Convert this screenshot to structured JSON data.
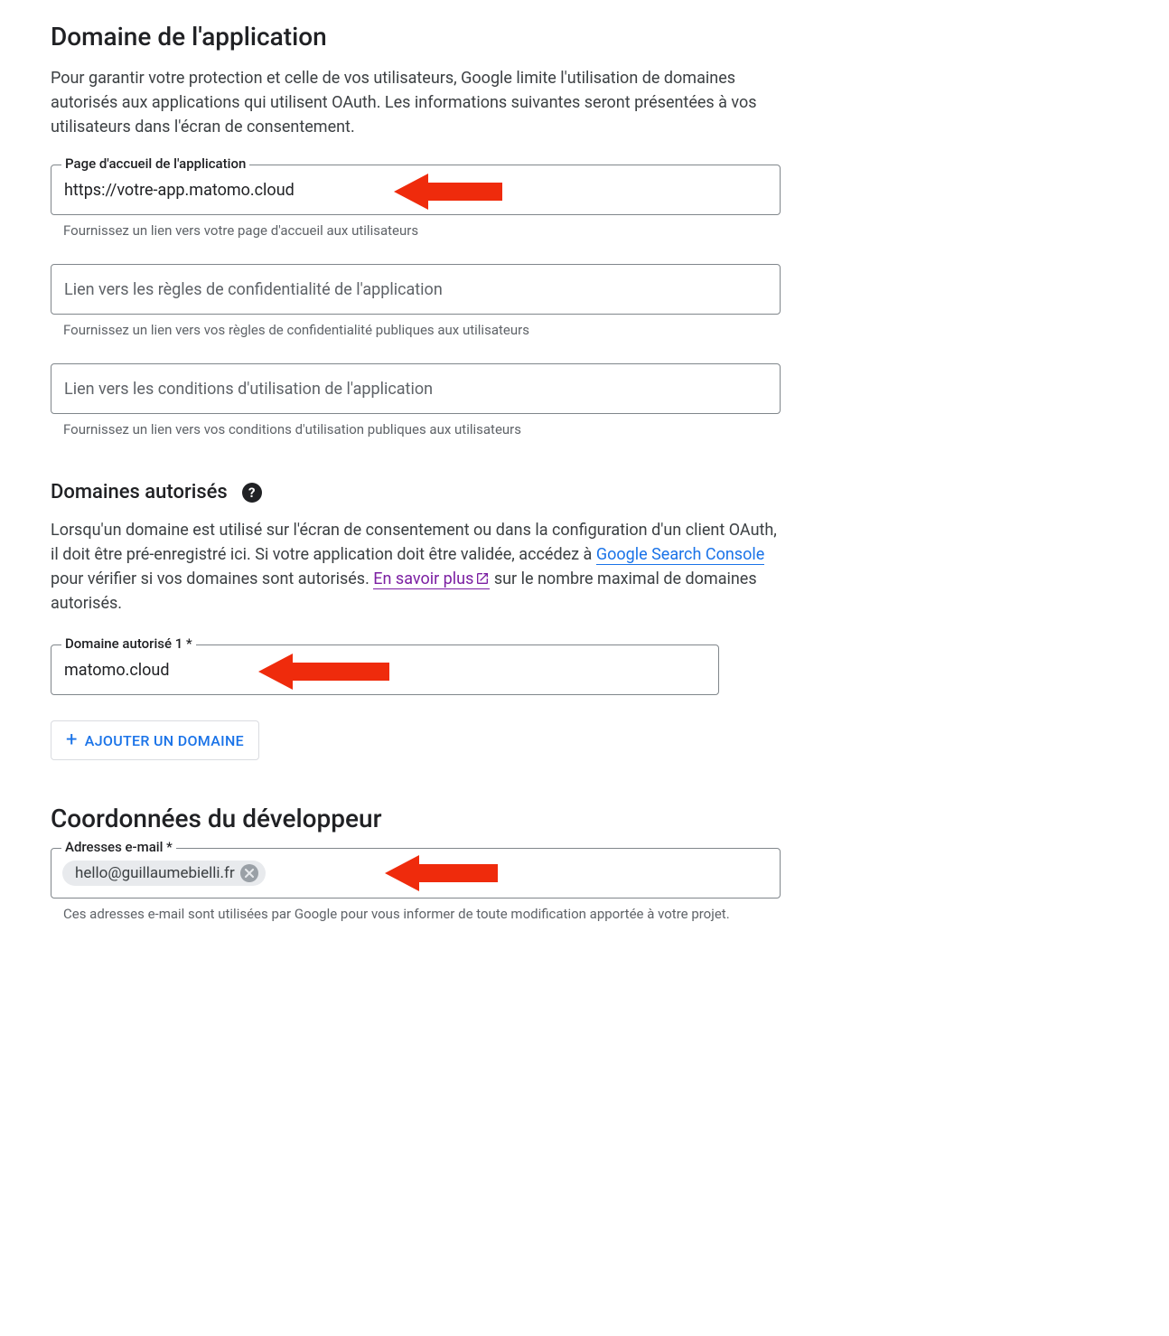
{
  "section_domain": {
    "title": "Domaine de l'application",
    "description": "Pour garantir votre protection et celle de vos utilisateurs, Google limite l'utilisation de domaines autorisés aux applications qui utilisent OAuth. Les informations suivantes seront présentées à vos utilisateurs dans l'écran de consentement.",
    "homepage": {
      "label": "Page d'accueil de l'application",
      "value": "https://votre-app.matomo.cloud",
      "helper": "Fournissez un lien vers votre page d'accueil aux utilisateurs"
    },
    "privacy": {
      "placeholder": "Lien vers les règles de confidentialité de l'application",
      "helper": "Fournissez un lien vers vos règles de confidentialité publiques aux utilisateurs"
    },
    "terms": {
      "placeholder": "Lien vers les conditions d'utilisation de l'application",
      "helper": "Fournissez un lien vers vos conditions d'utilisation publiques aux utilisateurs"
    }
  },
  "section_authorized": {
    "title": "Domaines autorisés",
    "desc_part1": "Lorsqu'un domaine est utilisé sur l'écran de consentement ou dans la configuration d'un client OAuth, il doit être pré-enregistré ici. Si votre application doit être validée, accédez à ",
    "link1_text": "Google Search Console",
    "desc_part2": " pour vérifier si vos domaines sont autorisés. ",
    "link2_text": "En savoir plus",
    "desc_part3": " sur le nombre maximal de domaines autorisés.",
    "domain1": {
      "label": "Domaine autorisé 1 *",
      "value": "matomo.cloud"
    },
    "add_button": "AJOUTER UN DOMAINE"
  },
  "section_developer": {
    "title": "Coordonnées du développeur",
    "email": {
      "label": "Adresses e-mail *",
      "chip": "hello@guillaumebielli.fr",
      "helper": "Ces adresses e-mail sont utilisées par Google pour vous informer de toute modification apportée à votre projet."
    }
  }
}
